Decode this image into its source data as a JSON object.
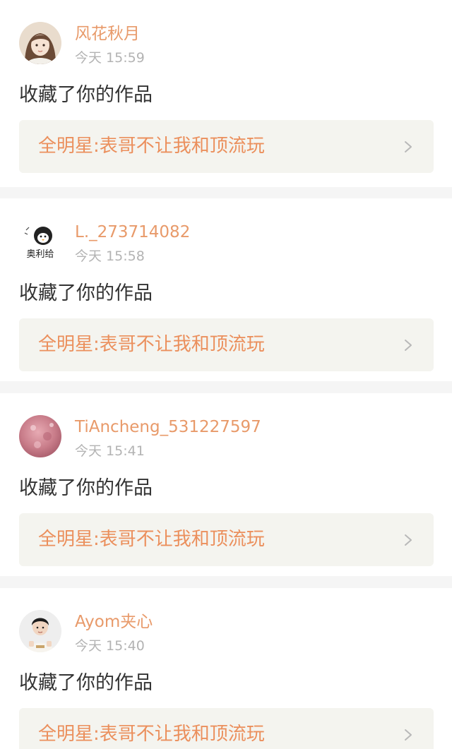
{
  "notifications": [
    {
      "username": "风花秋月",
      "time": "今天 15:59",
      "action": "收藏了你的作品",
      "work_title": "全明星:表哥不让我和顶流玩",
      "avatar": "girl-portrait-icon"
    },
    {
      "username": "L._273714082",
      "time": "今天 15:58",
      "action": "收藏了你的作品",
      "work_title": "全明星:表哥不让我和顶流玩",
      "avatar": "penguin-sticker-icon",
      "avatar_text": "奥利给"
    },
    {
      "username": "TiAncheng_531227597",
      "time": "今天 15:41",
      "action": "收藏了你的作品",
      "work_title": "全明星:表哥不让我和顶流玩",
      "avatar": "pink-texture-icon"
    },
    {
      "username": "Ayom夹心",
      "time": "今天 15:40",
      "action": "收藏了你的作品",
      "work_title": "全明星:表哥不让我和顶流玩",
      "avatar": "boy-portrait-icon"
    }
  ],
  "colors": {
    "username": "#e89a6a",
    "work_title": "#eb8f5c",
    "work_box_bg": "#f4f4ef",
    "time": "#b3b3b3",
    "separator": "#f5f5f5"
  }
}
